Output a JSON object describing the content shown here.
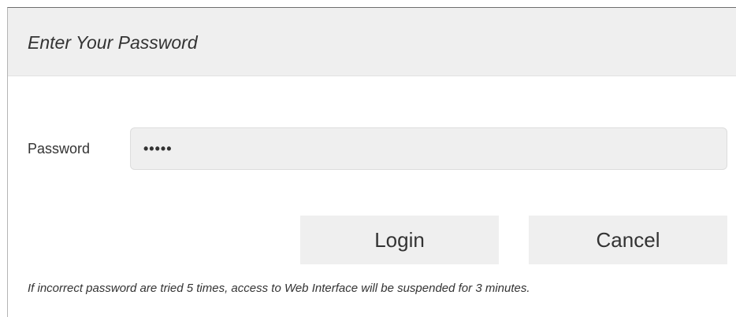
{
  "dialog": {
    "title": "Enter Your Password",
    "password_label": "Password",
    "password_value": "•••••",
    "login_label": "Login",
    "cancel_label": "Cancel",
    "notice": "If incorrect password are tried 5 times, access to Web Interface will be suspended for 3 minutes."
  }
}
